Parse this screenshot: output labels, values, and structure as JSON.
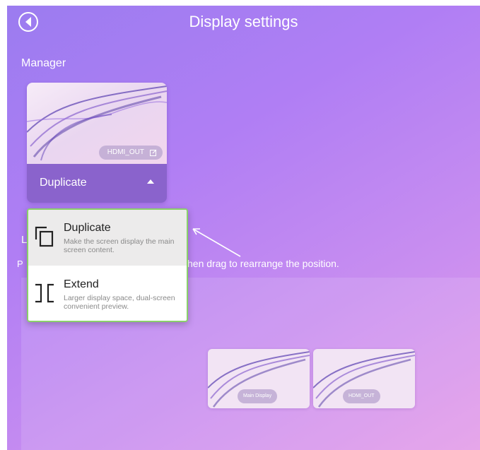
{
  "header": {
    "title": "Display settings"
  },
  "manager": {
    "label": "Manager",
    "card": {
      "output_badge": "HDMI_OUT",
      "mode_label": "Duplicate"
    }
  },
  "dropdown": {
    "options": [
      {
        "name": "Duplicate",
        "description": "Make the screen display the main screen content.",
        "selected": true
      },
      {
        "name": "Extend",
        "description": "Larger display space, dual-screen convenient preview.",
        "selected": false
      }
    ]
  },
  "layout_section": {
    "partial_heading": "L",
    "partial_instruction": "P",
    "instruction_visible": "hen drag to rearrange the position."
  },
  "arrangement": {
    "displays": [
      {
        "label": "Main Display"
      },
      {
        "label": "HDMI_OUT"
      }
    ]
  },
  "colors": {
    "accent": "#8a63cc",
    "popup_border": "#8bd06b",
    "background_start": "#9b7cf0",
    "background_end": "#e39ae8"
  }
}
